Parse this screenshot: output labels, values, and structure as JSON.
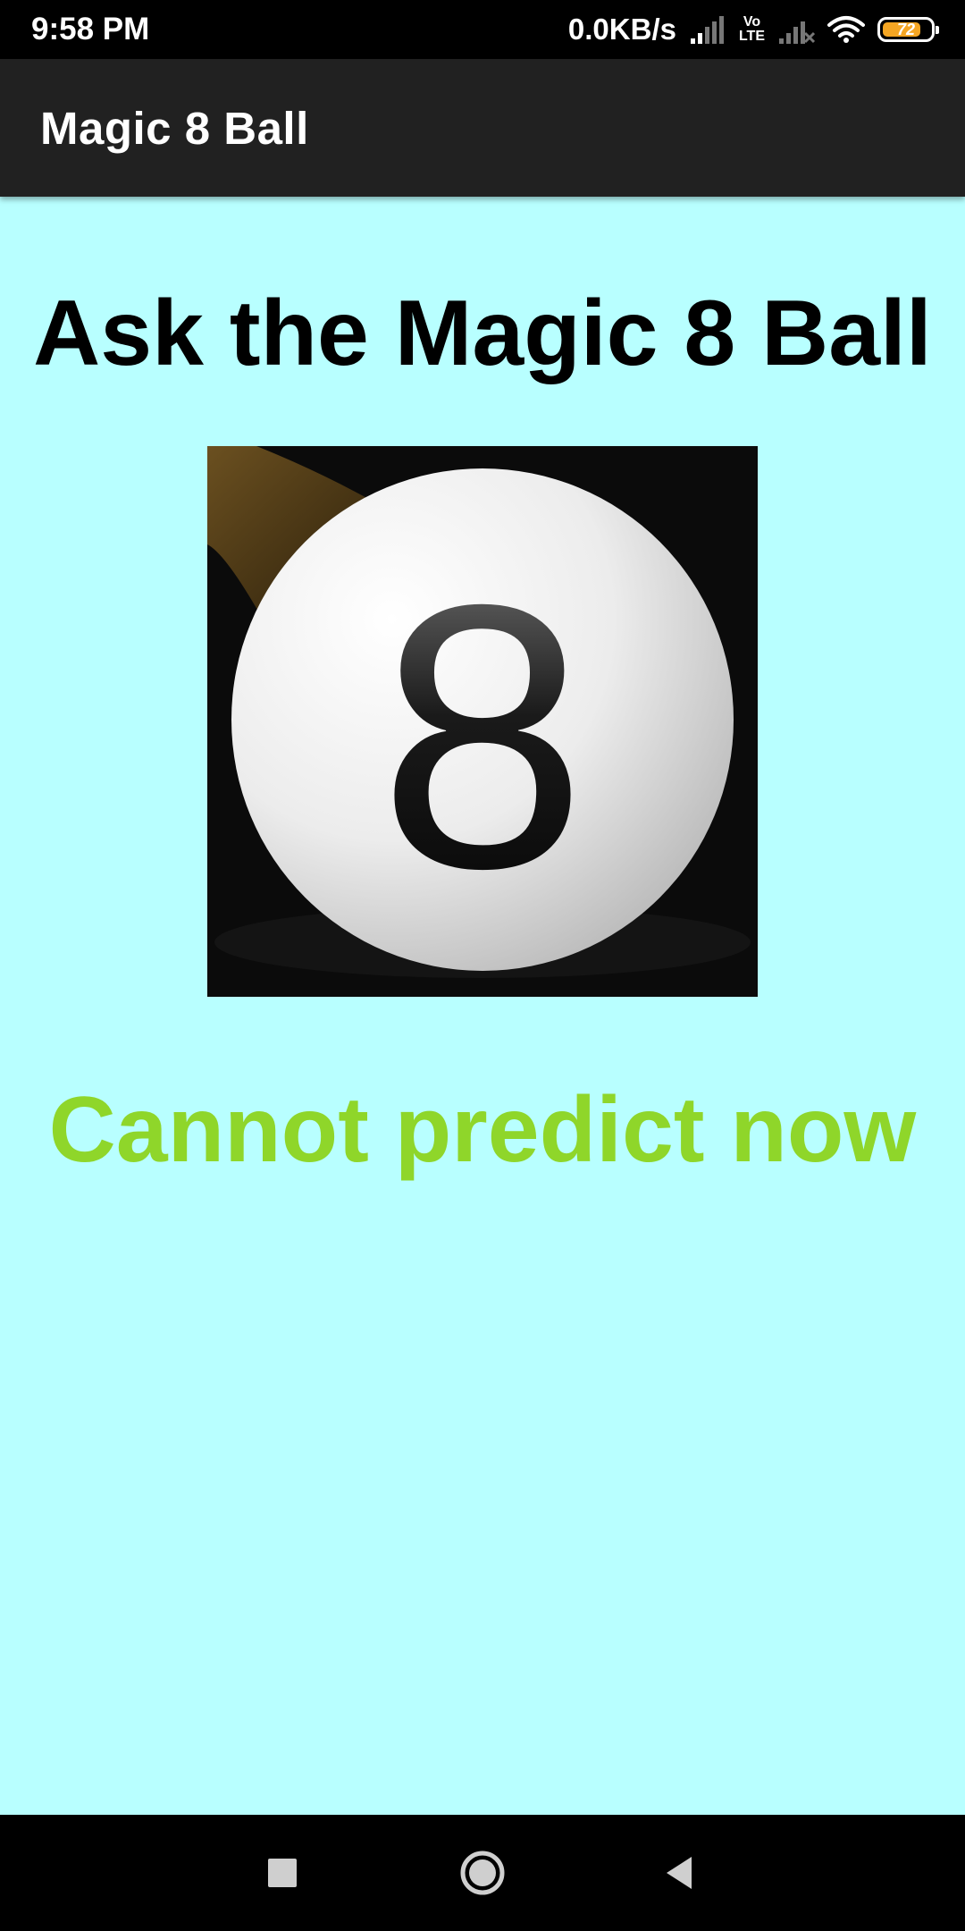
{
  "status_bar": {
    "time": "9:58 PM",
    "network_speed": "0.0KB/s",
    "volte_top": "Vo",
    "volte_bottom": "LTE",
    "battery_level": "72",
    "battery_color": "#f5a623"
  },
  "app_bar": {
    "title": "Magic 8 Ball",
    "background": "#212121"
  },
  "main": {
    "background": "#b8ffff",
    "heading": "Ask the Magic 8 Ball",
    "ball_number": "8",
    "answer": "Cannot predict now",
    "answer_color": "#8fd62a"
  },
  "nav_bar": {
    "recents_icon": "square-icon",
    "home_icon": "circle-icon",
    "back_icon": "triangle-back-icon"
  }
}
